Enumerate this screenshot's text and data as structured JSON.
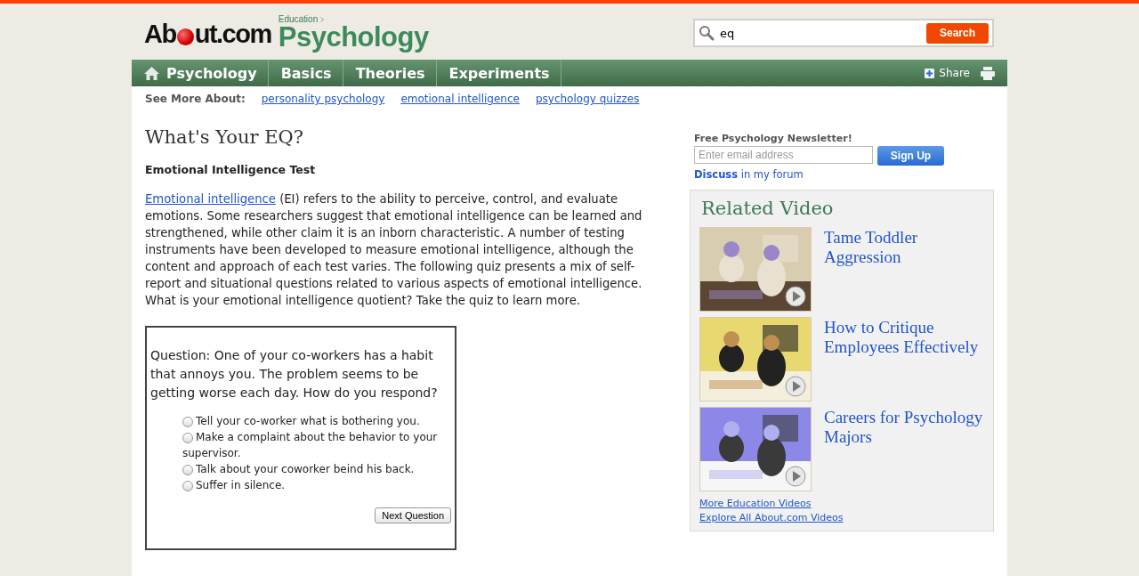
{
  "header": {
    "logo": {
      "before": "Ab",
      "after": "ut.com"
    },
    "breadcrumb": "Education",
    "site": "Psychology",
    "search": {
      "value": "eq",
      "button": "Search"
    }
  },
  "nav": {
    "items": [
      {
        "label": "Psychology",
        "home": true
      },
      {
        "label": "Basics",
        "home": false
      },
      {
        "label": "Theories",
        "home": false
      },
      {
        "label": "Experiments",
        "home": false
      }
    ],
    "share": "Share"
  },
  "see_more": {
    "label": "See More About:",
    "links": [
      "personality psychology",
      "emotional intelligence",
      "psychology quizzes"
    ]
  },
  "article": {
    "title": "What's Your EQ?",
    "subtitle": "Emotional Intelligence Test",
    "intro_link": "Emotional intelligence",
    "intro_text": " (EI) refers to the ability to perceive, control, and evaluate emotions. Some researchers suggest that emotional intelligence can be learned and strengthened, while other claim it is an inborn characteristic. A number of testing instruments have been developed to measure emotional intelligence, although the content and approach of each test varies. The following quiz presents a mix of self-report and situational questions related to various aspects of emotional intelligence. What is your emotional intelligence quotient? Take the quiz to learn more."
  },
  "quiz": {
    "question": "Question: One of your co-workers has a habit that annoys you. The problem seems to be getting worse each day. How do you respond?",
    "options": [
      {
        "label": "Tell your co-worker what is bothering you.",
        "selected": false
      },
      {
        "label": "Make a complaint about the behavior to your supervisor.",
        "selected": false
      },
      {
        "label": "Talk about your coworker beind his back.",
        "selected": false
      },
      {
        "label": "Suffer in silence.",
        "selected": false
      }
    ],
    "button": "Next Question"
  },
  "newsletter": {
    "title": "Free Psychology Newsletter!",
    "placeholder": "Enter email address",
    "button": "Sign Up",
    "discuss": "Discuss",
    "discuss_rest": "in my forum"
  },
  "related_video": {
    "title": "Related Video",
    "videos": [
      {
        "title": "Tame Toddler Aggression",
        "kind": "picture"
      },
      {
        "title": "How to Critique Employees Effectively",
        "kind": "picture"
      },
      {
        "title": "Careers for Psychology Majors",
        "kind": "picture"
      }
    ],
    "links": [
      "More Education Videos",
      "Explore All About.com Videos"
    ]
  }
}
